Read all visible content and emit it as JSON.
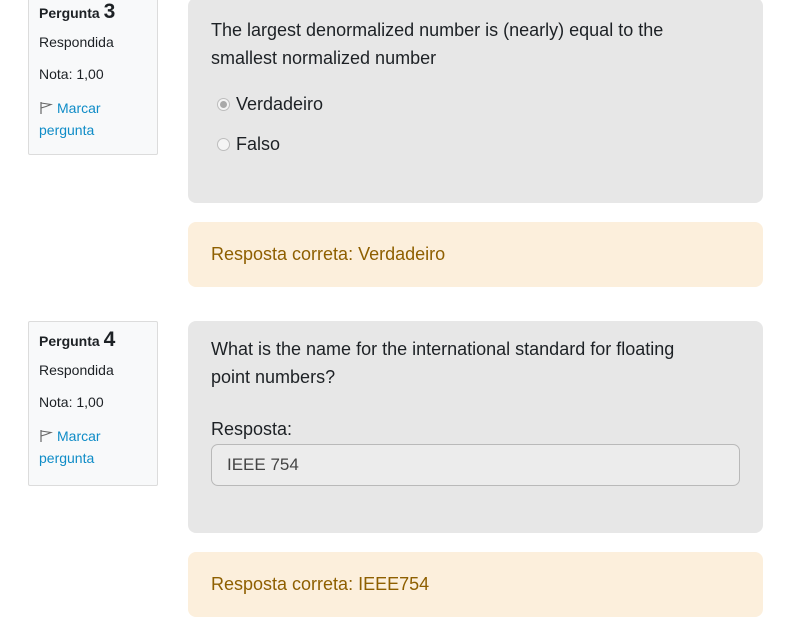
{
  "questions": [
    {
      "label": "Pergunta",
      "number": "3",
      "state": "Respondida",
      "grade": "Nota: 1,00",
      "flag_label": "Marcar pergunta",
      "text": "The largest denormalized number is (nearly) equal to the smallest normalized number",
      "options": [
        {
          "label": "Verdadeiro",
          "selected": true
        },
        {
          "label": "Falso",
          "selected": false
        }
      ],
      "feedback": "Resposta correta: Verdadeiro"
    },
    {
      "label": "Pergunta",
      "number": "4",
      "state": "Respondida",
      "grade": "Nota: 1,00",
      "flag_label": "Marcar pergunta",
      "text": "What is the name for the international standard for floating point numbers?",
      "answer_label": "Resposta:",
      "answer_value": "IEEE 754",
      "feedback": "Resposta correta: IEEE754"
    }
  ],
  "icons": {
    "flag": "flag-icon"
  },
  "colors": {
    "question_bg": "#e7e7e7",
    "feedback_bg": "#fcefdc",
    "feedback_text": "#8e5f00",
    "link": "#0f8cc7"
  }
}
